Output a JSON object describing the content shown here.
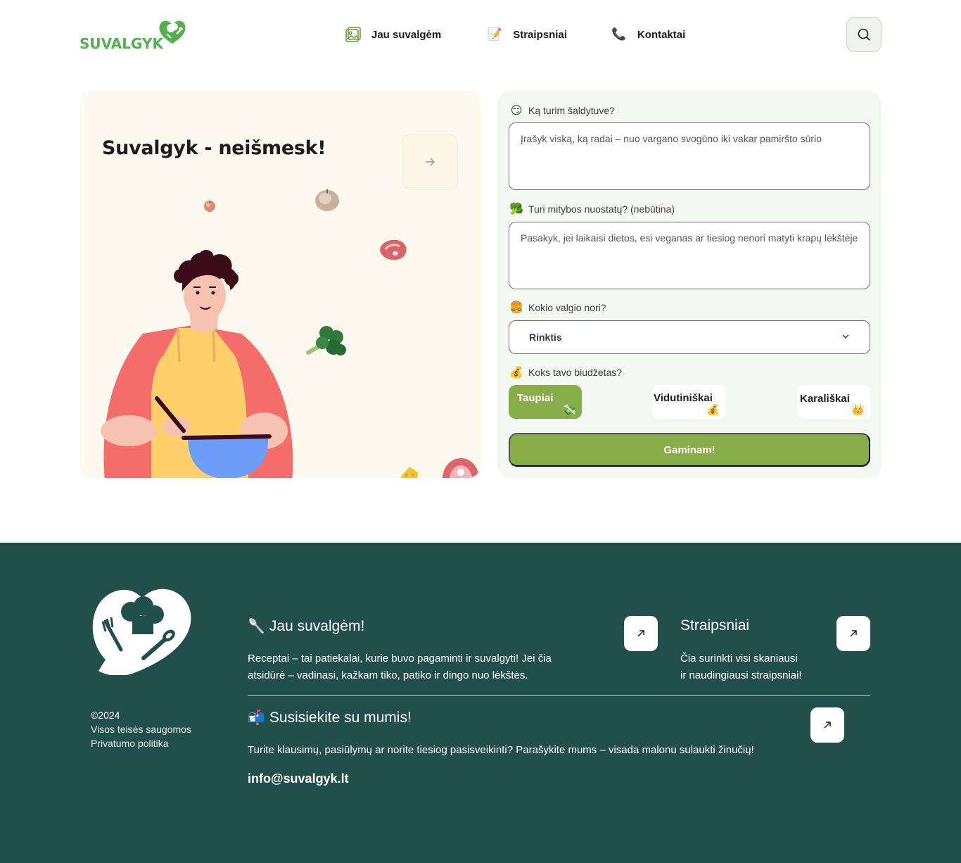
{
  "header": {
    "logo_text": "SUVALGYK",
    "nav": [
      {
        "label": "Jau suvalgėm",
        "icon": "gallery-icon"
      },
      {
        "label": "Straipsniai",
        "icon": "memo-icon"
      },
      {
        "label": "Kontaktai",
        "icon": "phone-icon"
      }
    ],
    "search_icon": "search-icon"
  },
  "hero": {
    "title": "Suvalgyk - neišmesk!",
    "arrow_icon": "arrow-right-icon"
  },
  "form": {
    "fridge": {
      "label": "Ką turim šaldytuve?",
      "emoji": "😏",
      "placeholder": "Įrašyk viską, ką radai – nuo vargano svogūno iki vakar pamiršto sūrio"
    },
    "diet": {
      "label": "Turi mitybos nuostatų? (nebūtina)",
      "emoji": "🥦",
      "placeholder": "Pasakyk, jei laikaisi dietos, esi veganas ar tiesiog nenori matyti krapų lėkštėje"
    },
    "meal": {
      "label": "Kokio valgio nori?",
      "emoji": "🍔",
      "selected": "Rinktis"
    },
    "budget": {
      "label": "Koks tavo biudžetas?",
      "emoji": "💰",
      "options": [
        {
          "label": "Taupiai",
          "emoji": "💸",
          "selected": true
        },
        {
          "label": "Vidutiniškai",
          "emoji": "💰",
          "selected": false
        },
        {
          "label": "Karališkai",
          "emoji": "👑",
          "selected": false
        }
      ]
    },
    "submit_label": "Gaminam!"
  },
  "footer": {
    "copyright": "©2024",
    "rights": "Visos teisės saugomos",
    "privacy": "Privatumo politika",
    "eaten": {
      "emoji": "🥄",
      "title": "Jau suvalgėm!",
      "text_line1": "Receptai – tai patiekalai, kurie buvo pagaminti ir suvalgyti! Jei čia",
      "text_line2": "atsidūrė – vadinasi, kažkam tiko, patiko ir dingo nuo lėkštės."
    },
    "articles": {
      "title": "Straipsniai",
      "text_line1": "Čia surinkti visi skaniausi",
      "text_line2": "ir naudingiausi straipsniai!"
    },
    "contact": {
      "emoji": "📬",
      "title": "Susisiekite su mumis!",
      "text": "Turite klausimų, pasiūlymų ar norite tiesiog pasisveikinti? Parašykite mums – visada malonu sulaukti žinučių!",
      "email": "info@suvalgyk.lt"
    }
  },
  "colors": {
    "brand_green": "#52b04f",
    "accent_olive": "#86ad47",
    "footer_bg": "#21504c",
    "hero_bg": "#fdf9ee",
    "panel_bg": "#f4f8f3"
  }
}
